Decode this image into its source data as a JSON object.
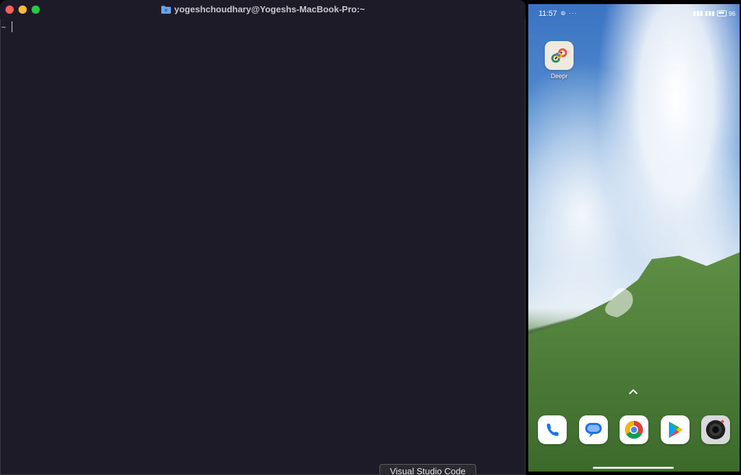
{
  "terminal": {
    "title": "yogeshchoudhary@Yogeshs-MacBook-Pro:~",
    "prompt": "~"
  },
  "tooltip": {
    "text": "Visual Studio Code"
  },
  "phone": {
    "status_bar": {
      "time": "11:57",
      "left_icons": "⊚ ···",
      "battery": "96"
    },
    "home_apps": [
      {
        "label": "Deepr",
        "icon": "deepr-icon"
      }
    ],
    "dock": [
      {
        "icon": "phone-icon"
      },
      {
        "icon": "messages-icon"
      },
      {
        "icon": "chrome-icon"
      },
      {
        "icon": "play-store-icon"
      },
      {
        "icon": "camera-icon"
      }
    ]
  }
}
